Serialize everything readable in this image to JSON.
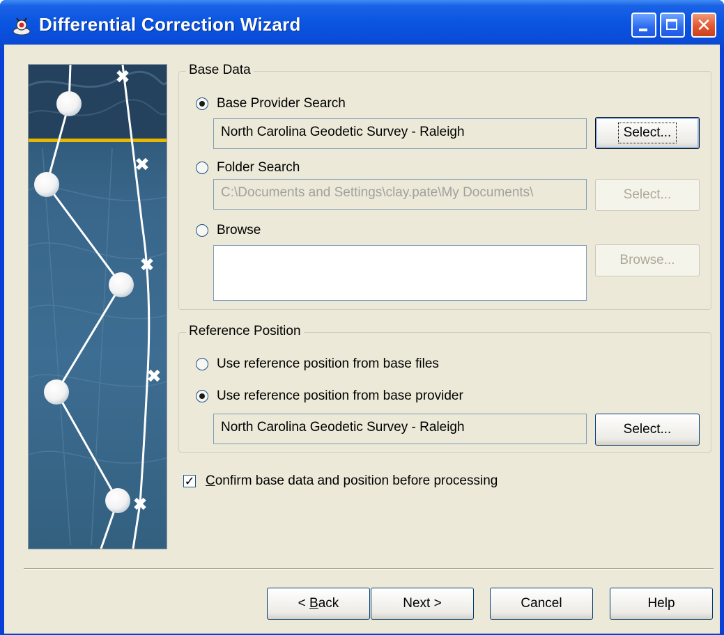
{
  "window": {
    "title": "Differential Correction Wizard",
    "controls": {
      "minimize": "minimize",
      "maximize": "maximize",
      "close": "close"
    }
  },
  "base_data": {
    "legend": "Base Data",
    "provider_search": {
      "label": "Base Provider Search",
      "selected": true,
      "value": "North Carolina Geodetic Survey - Raleigh",
      "button": "Select..."
    },
    "folder_search": {
      "label": "Folder Search",
      "selected": false,
      "value": "C:\\Documents and Settings\\clay.pate\\My Documents\\",
      "button": "Select..."
    },
    "browse": {
      "label": "Browse",
      "selected": false,
      "value": "",
      "button": "Browse..."
    }
  },
  "reference_position": {
    "legend": "Reference Position",
    "from_base_files": {
      "label": "Use reference position from base files",
      "selected": false
    },
    "from_base_provider": {
      "label": "Use reference position from base provider",
      "selected": true,
      "value": "North Carolina Geodetic Survey - Raleigh",
      "button": "Select..."
    }
  },
  "confirm": {
    "label_rest": "onfirm base data and position before processing",
    "mnemonic": "C",
    "checked": true
  },
  "footer": {
    "back": {
      "mnemonic": "B",
      "rest": "ack",
      "prefix": "< "
    },
    "next": "Next >",
    "cancel": "Cancel",
    "help": "Help"
  },
  "colors": {
    "titlebar": "#0a4cd8",
    "dialog_bg": "#ece9d8",
    "banner_accent": "#e8b800"
  }
}
